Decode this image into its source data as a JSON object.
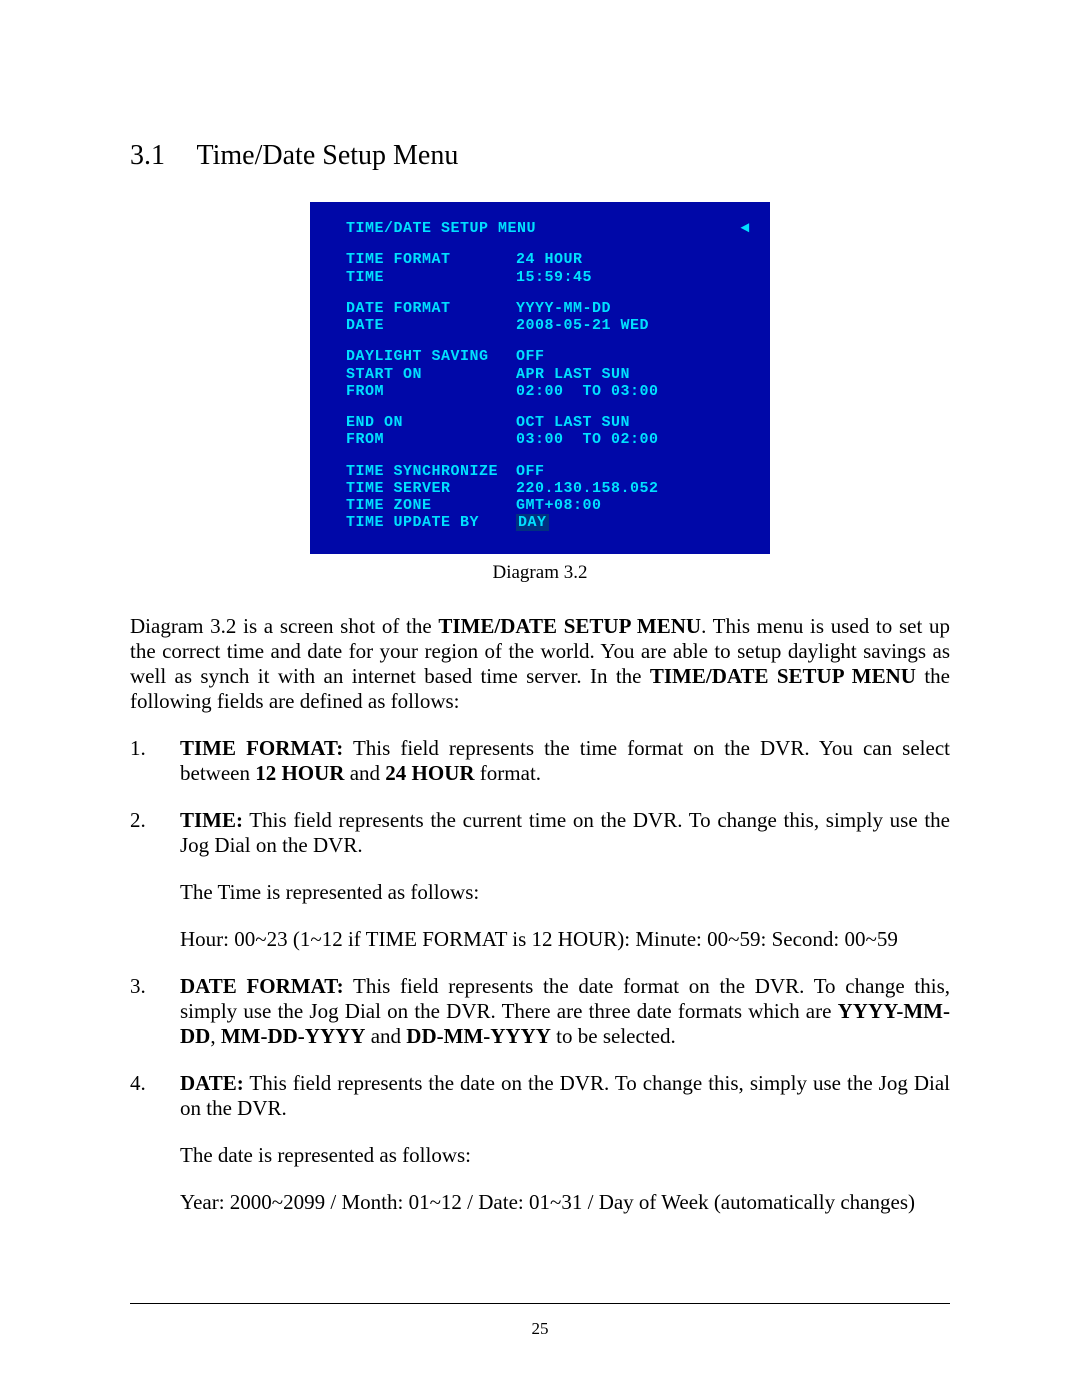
{
  "section": {
    "number": "3.1",
    "title": "Time/Date Setup Menu"
  },
  "diagram": {
    "title": "TIME/DATE SETUP MENU",
    "back_glyph": "◄",
    "rows": {
      "time_format": {
        "label": "TIME FORMAT",
        "value": "24 HOUR"
      },
      "time": {
        "label": "TIME",
        "value": "15:59:45"
      },
      "date_format": {
        "label": "DATE FORMAT",
        "value": "YYYY-MM-DD"
      },
      "date": {
        "label": "DATE",
        "value": "2008-05-21 WED"
      },
      "daylight_saving": {
        "label": "DAYLIGHT SAVING",
        "value": "OFF"
      },
      "start_on": {
        "label": "START ON",
        "value": "APR LAST SUN"
      },
      "start_from": {
        "label": "FROM",
        "value": "02:00  TO 03:00"
      },
      "end_on": {
        "label": "END   ON",
        "value": "OCT LAST SUN"
      },
      "end_from": {
        "label": "FROM",
        "value": "03:00  TO 02:00"
      },
      "time_sync": {
        "label": "TIME SYNCHRONIZE",
        "value": "OFF"
      },
      "time_server": {
        "label": "TIME SERVER",
        "value": "220.130.158.052"
      },
      "time_zone": {
        "label": "TIME ZONE",
        "value": "GMT+08:00"
      },
      "time_update_by": {
        "label": "TIME UPDATE BY",
        "value": "DAY"
      }
    }
  },
  "caption": "Diagram 3.2",
  "intro": {
    "p1_a": "Diagram 3.2 is a screen shot of the ",
    "p1_bold1": "TIME/DATE SETUP MENU",
    "p1_b": ". This menu is used to set up the correct time and date for your region of the world. You are able to setup daylight savings as well as synch it with an internet based time server. In the ",
    "p1_bold2": "TIME/DATE SETUP MENU",
    "p1_c": " the following fields are defined as follows:"
  },
  "items": {
    "i1": {
      "num": "1.",
      "lead_bold": "TIME FORMAT:",
      "lead_rest": " This field represents the time format on the DVR. You can select between ",
      "b1": "12 HOUR",
      "mid1": " and ",
      "b2": "24 HOUR",
      "tail": " format."
    },
    "i2": {
      "num": "2.",
      "lead_bold": "TIME:",
      "lead_rest": " This field represents the current time on the DVR. To change this, simply use the Jog Dial on the DVR.",
      "sub1": "The Time is represented as follows:",
      "sub2": "Hour: 00~23 (1~12 if TIME FORMAT is 12 HOUR): Minute: 00~59: Second: 00~59"
    },
    "i3": {
      "num": "3.",
      "lead_bold": "DATE FORMAT:",
      "lead_rest": " This field represents the date format on the DVR. To change this, simply use the Jog Dial on the DVR. There are three date formats which are ",
      "b1": "YYYY-MM-DD",
      "mid1": ", ",
      "b2": "MM-DD-YYYY",
      "mid2": " and ",
      "b3": "DD-MM-YYYY",
      "tail": " to be selected."
    },
    "i4": {
      "num": "4.",
      "lead_bold": "DATE:",
      "lead_rest": " This field represents the date on the DVR. To change this, simply use the Jog Dial on the DVR.",
      "sub1": "The date is represented as follows:",
      "sub2": "Year: 2000~2099 / Month: 01~12 / Date: 01~31 / Day of Week (automatically changes)"
    }
  },
  "page_number": "25"
}
